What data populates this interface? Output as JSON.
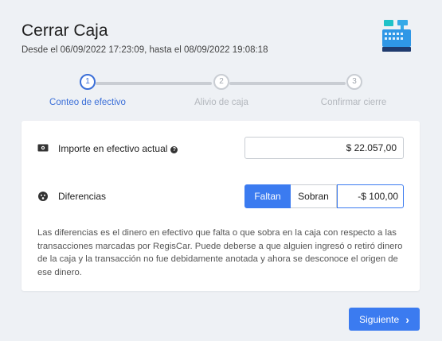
{
  "header": {
    "title": "Cerrar Caja",
    "subtitle": "Desde el 06/09/2022 17:23:09, hasta el 08/09/2022 19:08:18",
    "icon": "cash-register-icon"
  },
  "stepper": {
    "steps": [
      {
        "number": "1",
        "label": "Conteo de efectivo",
        "active": true
      },
      {
        "number": "2",
        "label": "Alivio de caja",
        "active": false
      },
      {
        "number": "3",
        "label": "Confirmar cierre",
        "active": false
      }
    ]
  },
  "form": {
    "cash": {
      "label": "Importe en efectivo actual",
      "value": "$ 22.057,00",
      "icon": "money-bill-icon",
      "help_icon": "question-circle-icon"
    },
    "differences": {
      "label": "Diferencias",
      "icon": "face-icon",
      "options": [
        "Faltan",
        "Sobran"
      ],
      "selected": "Faltan",
      "value": "-$ 100,00"
    },
    "description": "Las diferencias es el dinero en efectivo que falta o que sobra en la caja con respecto a las transacciones marcadas por RegisCar. Puede deberse a que alguien ingresó o retiró dinero de la caja y la transacción no fue debidamente anotada y ahora se desconoce el origen de ese dinero."
  },
  "footer": {
    "next_label": "Siguiente"
  },
  "colors": {
    "accent": "#3b7bf0",
    "step_active": "#3b6fd8",
    "background": "#eef1f5"
  }
}
